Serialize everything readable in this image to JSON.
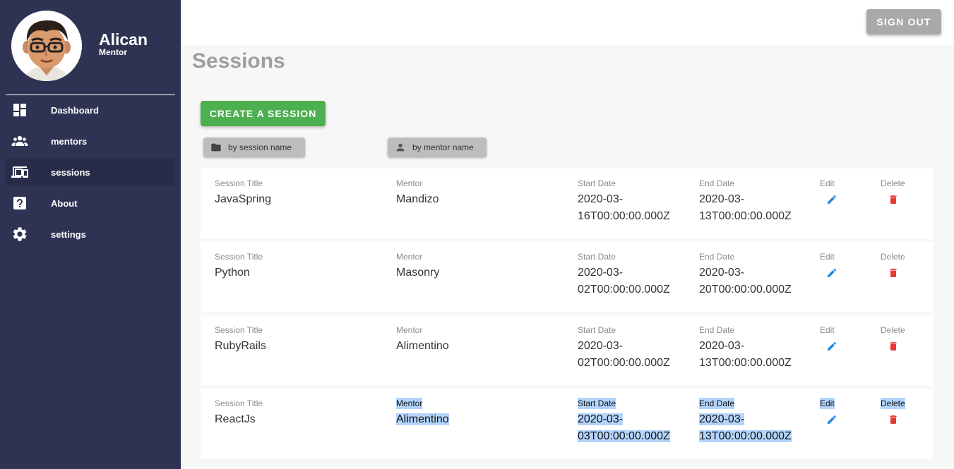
{
  "user": {
    "name": "Alican",
    "role": "Mentor"
  },
  "sidebar": {
    "items": [
      {
        "label": "Dashboard",
        "icon": "dashboard-icon"
      },
      {
        "label": "mentors",
        "icon": "people-icon"
      },
      {
        "label": "sessions",
        "icon": "monitor-icon",
        "active": true
      },
      {
        "label": "About",
        "icon": "help-icon"
      },
      {
        "label": "settings",
        "icon": "gear-icon"
      }
    ]
  },
  "topbar": {
    "signout_label": "SIGN OUT"
  },
  "main": {
    "title": "Sessions",
    "create_label": "CREATE A SESSION",
    "filters": {
      "by_session": "by session name",
      "by_mentor": "by mentor name"
    },
    "columns": {
      "title": "Session Title",
      "mentor": "Mentor",
      "start": "Start Date",
      "end": "End Date",
      "edit": "Edit",
      "delete": "Delete"
    },
    "sessions": [
      {
        "title": "JavaSpring",
        "mentor": "Mandizo",
        "start_1": "2020-03-",
        "start_2": "16T00:00:00.000Z",
        "end_1": "2020-03-",
        "end_2": "13T00:00:00.000Z"
      },
      {
        "title": "Python",
        "mentor": "Masonry",
        "start_1": "2020-03-",
        "start_2": "02T00:00:00.000Z",
        "end_1": "2020-03-",
        "end_2": "20T00:00:00.000Z"
      },
      {
        "title": "RubyRails",
        "mentor": "Alimentino",
        "start_1": "2020-03-",
        "start_2": "02T00:00:00.000Z",
        "end_1": "2020-03-",
        "end_2": "13T00:00:00.000Z"
      },
      {
        "title": "ReactJs",
        "mentor": "Alimentino",
        "start_1": "2020-03-",
        "start_2": "03T00:00:00.000Z",
        "end_1": "2020-03-",
        "end_2": "13T00:00:00.000Z"
      }
    ]
  },
  "colors": {
    "sidebar_bg": "#2e3353",
    "create_button": "#4caf50",
    "signout_button": "#a9a9a9",
    "edit_icon": "#1e88e5",
    "delete_icon": "#e53935",
    "selection": "#b3d4fc"
  }
}
